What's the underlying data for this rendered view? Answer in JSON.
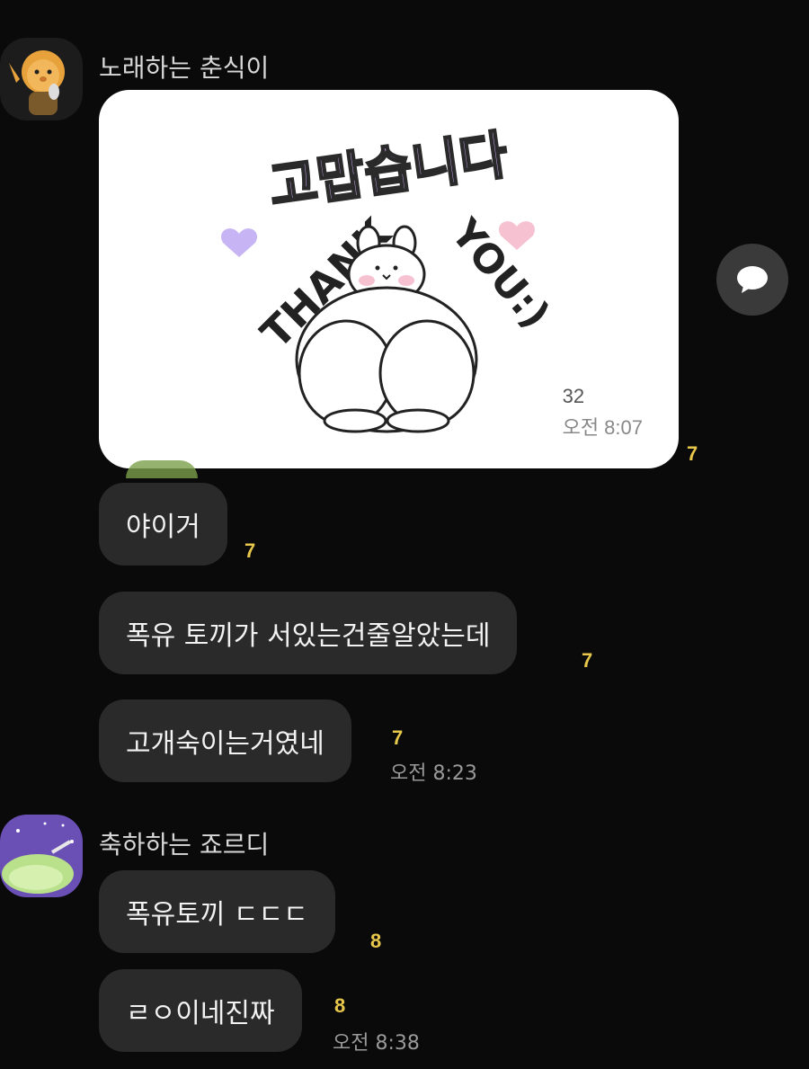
{
  "messages_group_1": {
    "sender_name": "노래하는 춘식이",
    "sticker": {
      "title_text": "고맙습니다",
      "thank_text": "THANK",
      "you_text": "YOU:)",
      "count": "32",
      "time": "오전 8:07"
    },
    "sticker_unread": "7",
    "bubbles": [
      {
        "text": "야이거",
        "unread": "7"
      },
      {
        "text": "폭유 토끼가 서있는건줄알았는데",
        "unread": "7"
      },
      {
        "text": "고개숙이는거였네",
        "unread": "7",
        "time": "오전 8:23"
      }
    ]
  },
  "messages_group_2": {
    "sender_name": "축하하는 죠르디",
    "bubbles": [
      {
        "text": "폭유토끼 ㄷㄷㄷ",
        "unread": "8"
      },
      {
        "text": "ㄹㅇ이네진짜",
        "unread": "8",
        "time": "오전 8:38"
      }
    ]
  },
  "icons": {
    "share": "speech-bubble-icon",
    "avatar_1": "lion-character-avatar",
    "avatar_2": "dinosaur-character-avatar"
  },
  "colors": {
    "background": "#0a0a0a",
    "bubble": "#2a2a2a",
    "unread": "#e8c84a"
  }
}
